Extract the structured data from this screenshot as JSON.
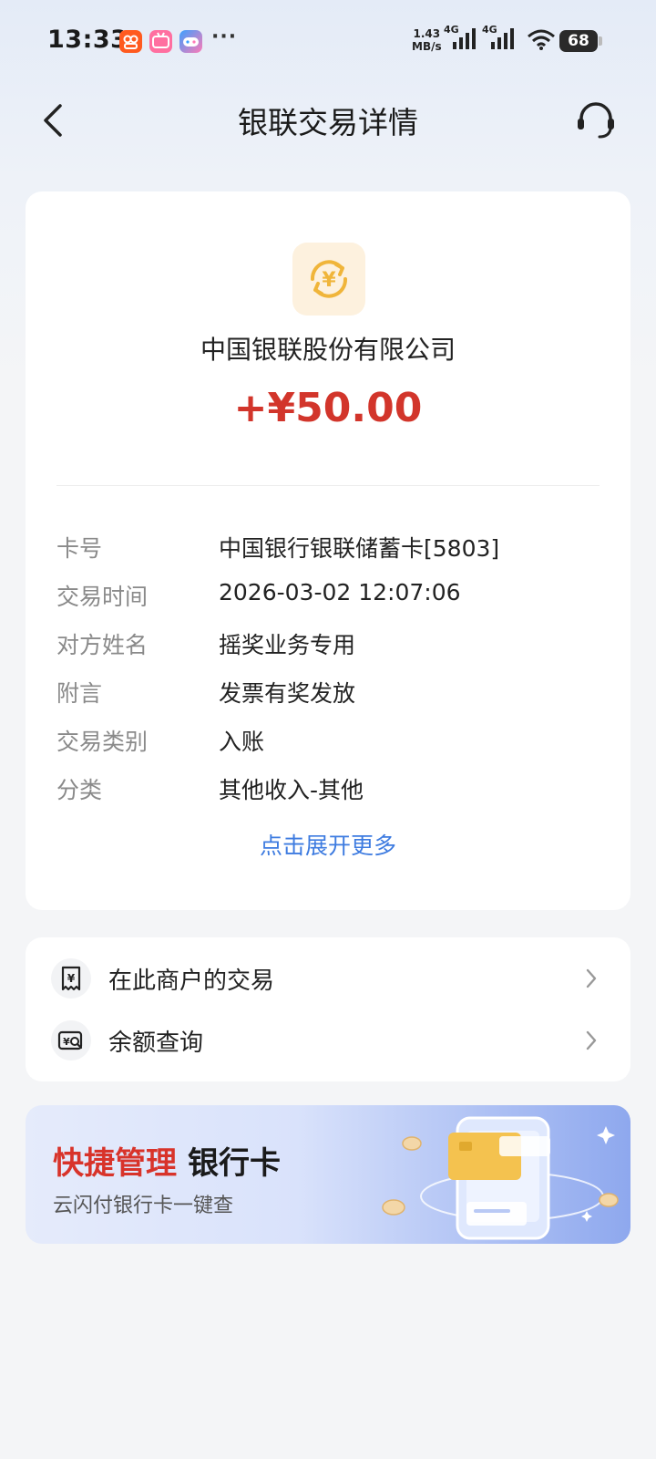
{
  "status_bar": {
    "time": "13:33",
    "more": "···",
    "net_speed_value": "1.43",
    "net_speed_unit": "MB/s",
    "sim1_label": "4G",
    "sim2_label": "4G",
    "battery": "68"
  },
  "header": {
    "title": "银联交易详情"
  },
  "transaction": {
    "merchant_name": "中国银联股份有限公司",
    "amount": "+¥50.00",
    "details": [
      {
        "label": "卡号",
        "value": "中国银行银联储蓄卡[5803]"
      },
      {
        "label": "交易时间",
        "value": "2026-03-02 12:07:06"
      },
      {
        "label": "对方姓名",
        "value": "摇奖业务专用"
      },
      {
        "label": "附言",
        "value": "发票有奖发放"
      },
      {
        "label": "交易类别",
        "value": "入账"
      },
      {
        "label": "分类",
        "value": "其他收入-其他"
      }
    ],
    "expand_label": "点击展开更多"
  },
  "actions": [
    {
      "label": "在此商户的交易",
      "icon": "receipt-yen-icon"
    },
    {
      "label": "余额查询",
      "icon": "balance-search-icon"
    }
  ],
  "banner": {
    "title_highlight": "快捷管理",
    "title_rest": "银行卡",
    "subtitle": "云闪付银行卡一键查"
  },
  "colors": {
    "amount": "#d2352b",
    "link": "#3d7be0",
    "banner_highlight": "#d8332a"
  }
}
